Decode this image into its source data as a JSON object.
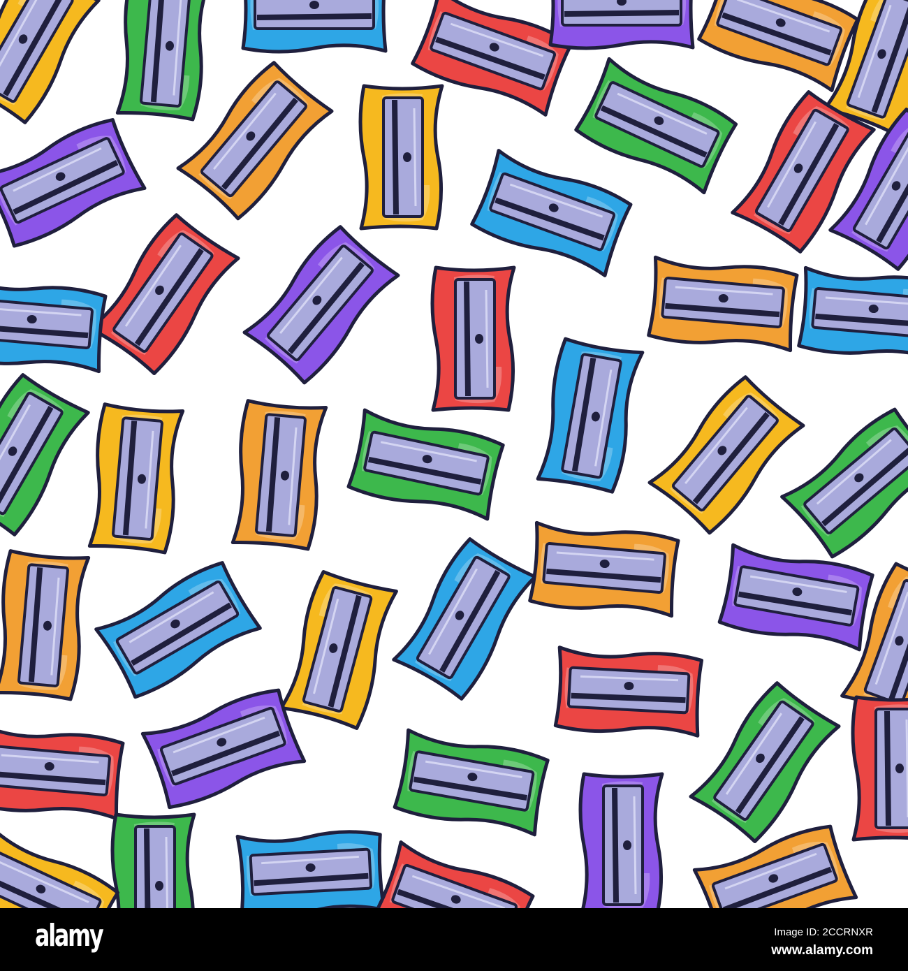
{
  "palette": {
    "yellow": "#f6b91f",
    "orange": "#f2a034",
    "green": "#3db84c",
    "blue": "#2ea6e6",
    "red": "#eb4644",
    "purple": "#8b55e8",
    "outline": "#1f1f3d",
    "blade": "#a9aadc"
  },
  "watermark": {
    "logo": "alamy",
    "image_id": "Image ID: 2CCRNXR",
    "url": "www.alamy.com"
  }
}
